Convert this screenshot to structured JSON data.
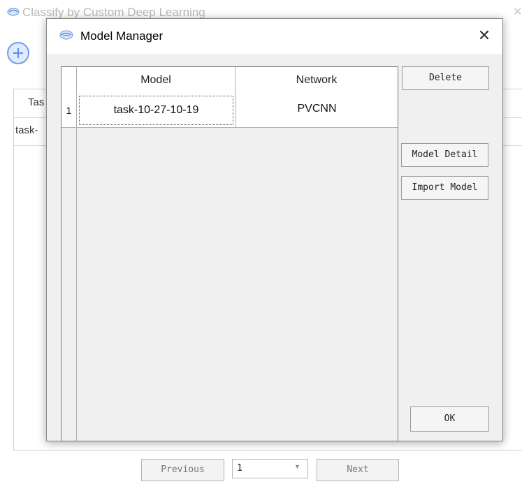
{
  "background_window": {
    "title": "Classify by Custom Deep Learning",
    "table_header_first_col": "Tas",
    "table_first_cell": "task-"
  },
  "pager": {
    "previous_label": "Previous",
    "page_value": "1",
    "next_label": "Next"
  },
  "dialog": {
    "title": "Model Manager",
    "close_glyph": "✕",
    "columns": [
      "Model",
      "Network"
    ],
    "rows": [
      {
        "index": "1",
        "model": "task-10-27-10-19",
        "network": "PVCNN"
      }
    ],
    "buttons": {
      "delete": "Delete",
      "model_detail": "Model Detail",
      "import_model": "Import Model",
      "ok": "OK"
    }
  },
  "icons": {
    "app_logo": "leaddeep-logo-icon",
    "add": "plus-circle-icon",
    "close": "close-icon",
    "dropdown": "chevron-down-icon"
  },
  "colors": {
    "accent": "#5b8fe8",
    "dialog_bg": "#f0f0f0"
  }
}
